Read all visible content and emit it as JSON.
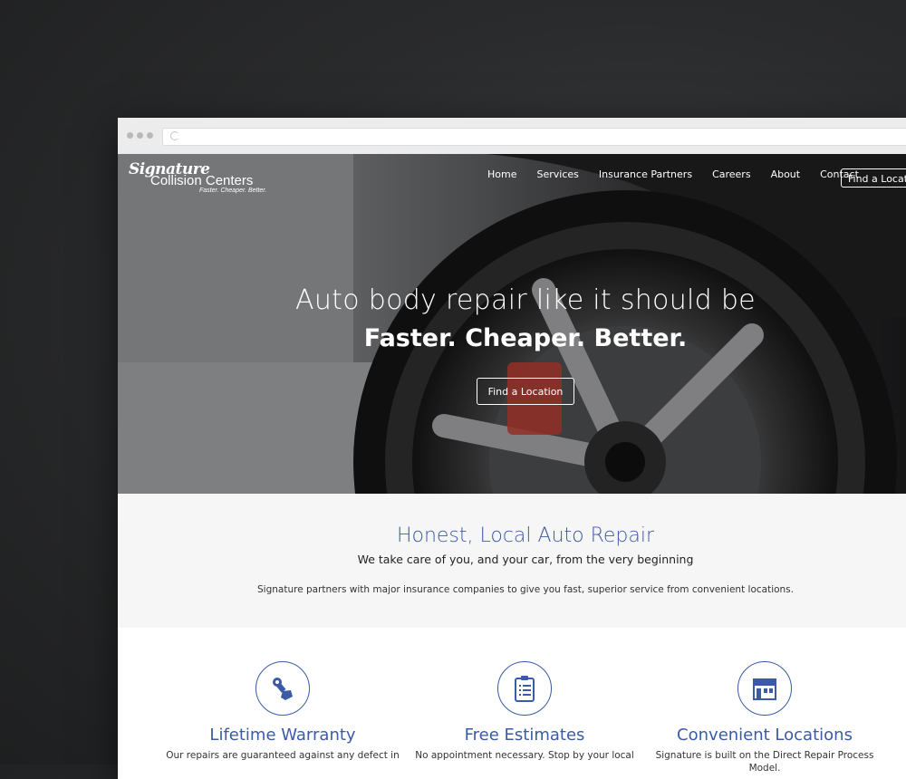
{
  "browser": {
    "url": ""
  },
  "logo": {
    "script": "Signature",
    "name": "Collision Centers",
    "tagline": "Faster. Cheaper. Better."
  },
  "nav": {
    "items": [
      "Home",
      "Services",
      "Insurance Partners",
      "Careers",
      "About",
      "Contact"
    ],
    "cta": "Find a Location"
  },
  "hero": {
    "title": "Auto body repair like it should be",
    "subtitle": "Faster. Cheaper. Better.",
    "button": "Find a Location"
  },
  "intro": {
    "title": "Honest, Local Auto Repair",
    "subtitle": "We take care of you, and your car, from the very beginning",
    "body": "Signature partners with major insurance companies to give you fast, superior service from convenient locations."
  },
  "features": [
    {
      "icon": "wrench-hand-icon",
      "title": "Lifetime Warranty",
      "body": "Our repairs are guaranteed against any defect in"
    },
    {
      "icon": "clipboard-icon",
      "title": "Free Estimates",
      "body": "No appointment necessary. Stop by your local"
    },
    {
      "icon": "storefront-icon",
      "title": "Convenient Locations",
      "body": "Signature is built on the Direct Repair Process Model."
    }
  ],
  "colors": {
    "accent": "#3b5ba5",
    "background": "#2a2b2c"
  }
}
